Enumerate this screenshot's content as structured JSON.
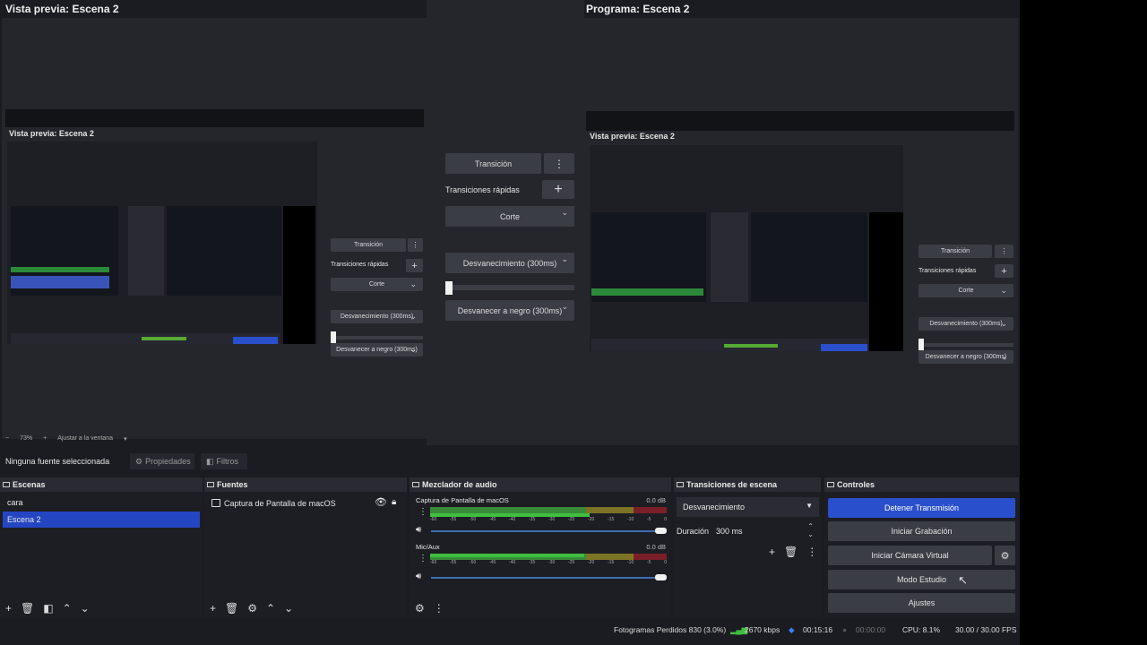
{
  "preview": {
    "title": "Vista previa: Escena 2",
    "zoom": "73%",
    "fit": "Ajustar a la ventana"
  },
  "program": {
    "title": "Programa: Escena 2"
  },
  "transition_center": {
    "transition_label": "Transición",
    "quick_label": "Transiciones rápidas",
    "items": [
      "Corte",
      "Desvanecimiento (300ms)",
      "Desvanecer a negro (300ms)"
    ]
  },
  "nested": {
    "preview_title": "Vista previa: Escena 2",
    "program_title": "Programa: Escena 2",
    "inner_title": "Vista previa: Escena 2"
  },
  "source_bar": {
    "status": "Ninguna fuente seleccionada",
    "properties": "Propiedades",
    "filters": "Filtros"
  },
  "scenes": {
    "title": "Escenas",
    "items": [
      "cara",
      "Escena 2"
    ],
    "selected": 1
  },
  "sources": {
    "title": "Fuentes",
    "items": [
      {
        "label": "Captura de Pantalla de macOS",
        "visible": true,
        "locked": true
      }
    ]
  },
  "mixer": {
    "title": "Mezclador de audio",
    "channels": [
      {
        "name": "Captura de Pantalla de macOS",
        "db": "0.0 dB",
        "volume": 1.0
      },
      {
        "name": "Mic/Aux",
        "db": "0.0 dB",
        "volume": 1.0
      }
    ],
    "scale": [
      "-60",
      "-55",
      "-50",
      "-45",
      "-40",
      "-35",
      "-30",
      "-25",
      "-20",
      "-15",
      "-10",
      "-5",
      "0"
    ]
  },
  "scene_transitions": {
    "title": "Transiciones de escena",
    "selected": "Desvanecimiento",
    "duration_label": "Duración",
    "duration_value": "300 ms"
  },
  "controls": {
    "title": "Controles",
    "stop_stream": "Detener Transmisión",
    "start_recording": "Iniciar Grabación",
    "start_virtual_cam": "Iniciar Cámara Virtual",
    "studio_mode": "Modo Estudio",
    "settings": "Ajustes"
  },
  "status": {
    "dropped": "Fotogramas Perdidos 830 (3.0%)",
    "bitrate": "2670 kbps",
    "stream_time": "00:15:16",
    "rec_time": "00:00:00",
    "cpu": "CPU: 8.1%",
    "fps": "30.00 / 30.00 FPS"
  },
  "colors": {
    "accent": "#2a4fcc",
    "selected": "#2546c2",
    "meter_green": "#3fbf3f",
    "meter_yellow": "#c9b82a",
    "meter_red": "#c0303a"
  }
}
